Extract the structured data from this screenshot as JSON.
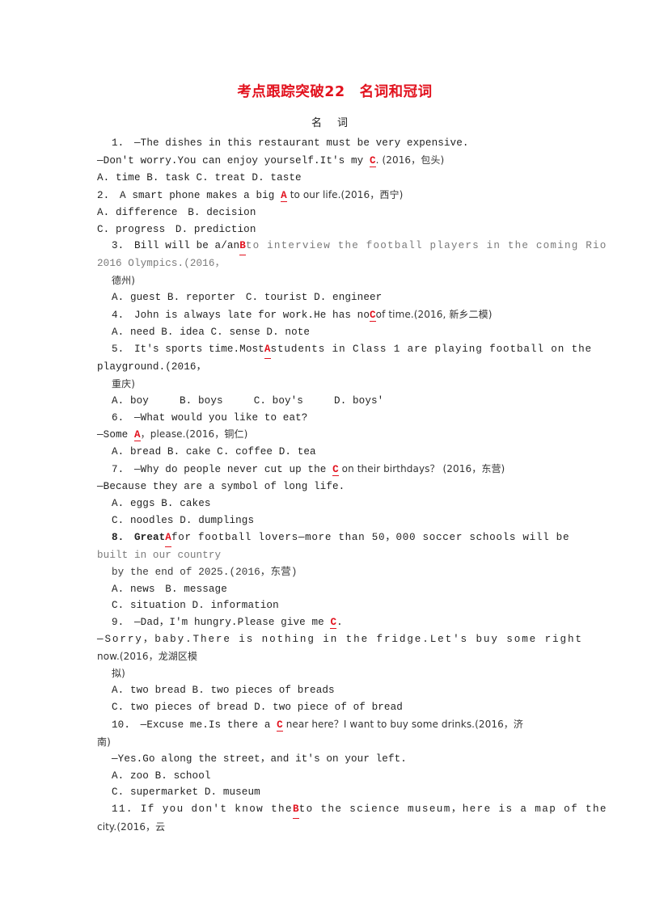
{
  "document": {
    "title": "考点跟踪突破22　名词和冠词",
    "section_heading": "名　词"
  },
  "questions": [
    {
      "id": "q1",
      "number": "1.",
      "lines": [
        "1.　—The dishes in this restaurant must be very expensive.",
        "—Don't worry.You can enjoy yourself.It's my ",
        ". (2016，包头)",
        "A. time  B. task  C. treat  D. taste"
      ],
      "answer": "C",
      "source": "(2016，包头)",
      "options": "A. time  B. task  C. treat  D. taste"
    },
    {
      "id": "q2",
      "number": "2.",
      "stem_before": "2.　A smart phone makes a big ",
      "answer": "A",
      "stem_after": " to our life.(2016，西宁)",
      "options_line1": "A. difference　B. decision",
      "options_line2": "C. progress　D. prediction"
    },
    {
      "id": "q3",
      "number": "3.",
      "stem_l1_a": "3.　Bill will be a/an ",
      "answer": "B",
      "stem_l1_b": " to interview the football players in the coming Rio",
      "stem_l2": "2016 Olympics.(2016，",
      "stem_l3": "德州)",
      "options": "A. guest  B. reporter　C. tourist  D. engineer"
    },
    {
      "id": "q4",
      "number": "4.",
      "stem_a": "4.　John is always late for work.He has no",
      "answer": "C",
      "stem_b": "of time.(2016, 新乡二模)",
      "options": "A. need  B. idea  C. sense  D. note"
    },
    {
      "id": "q5",
      "number": "5.",
      "stem_l1_a": "5.　It's sports time.Most ",
      "answer": "A",
      "stem_l1_b": " students in Class 1 are playing football on the",
      "stem_l2": "playground.(2016，",
      "stem_l3": "重庆)",
      "options": "A. boy　　　B. boys　　　C. boy's　　　D. boys'"
    },
    {
      "id": "q6",
      "number": "6.",
      "stem_l1": "6.　—What would you like to eat?",
      "stem_l2_a": "—Some ",
      "answer": "A",
      "stem_l2_b": "，please.(2016，铜仁)",
      "options": "A. bread  B. cake  C. coffee  D. tea"
    },
    {
      "id": "q7",
      "number": "7.",
      "stem_l1_a": "7.　—Why do people never cut up the ",
      "answer": "C",
      "stem_l1_b": " on their birthdays？ (2016，东营)",
      "stem_l2": "—Because they are a symbol of long life.",
      "options_line1": "A. eggs  B. cakes",
      "options_line2": "C. noodles  D. dumplings"
    },
    {
      "id": "q8",
      "number": "8.",
      "stem_l1_a": "8.　Great ",
      "answer": "A",
      "stem_l1_b": " for football lovers—more than 50，000 soccer schools will be",
      "stem_l2": "built in our country",
      "stem_l3": "by the end of 2025.(2016，东营)",
      "options_line1": "A. news　B. message",
      "options_line2": "C. situation  D. information"
    },
    {
      "id": "q9",
      "number": "9.",
      "stem_l1_a": "9.　—Dad，I'm hungry.Please give me ",
      "answer": "C",
      "stem_l1_b": ".",
      "stem_l2": "—Sorry，baby.There is nothing in the fridge.Let's buy some right",
      "stem_l3": "now.(2016，龙湖区模",
      "stem_l4": "拟)",
      "options_line1": "A. two bread  B. two pieces of breads",
      "options_line2": "C. two pieces of bread  D. two piece of of bread"
    },
    {
      "id": "q10",
      "number": "10.",
      "stem_l1_a": "10.　—Excuse me.Is there a ",
      "answer": "C",
      "stem_l1_b": " near here？I want to buy some drinks.(2016，济",
      "stem_l2": "南)",
      "stem_l3": "—Yes.Go along the street，and it's on your left.",
      "options_line1": "A. zoo  B. school",
      "options_line2": "C. supermarket  D. museum"
    },
    {
      "id": "q11",
      "number": "11.",
      "stem_l1_a": "11. If you don't know the ",
      "answer": "B",
      "stem_l1_b": " to the science museum，here is a map of the",
      "stem_l2": "city.(2016，云"
    }
  ],
  "colors": {
    "answer_red": "#e2121e",
    "title_red": "#e2121e",
    "body_text": "#222222",
    "page_background": "#ffffff"
  }
}
